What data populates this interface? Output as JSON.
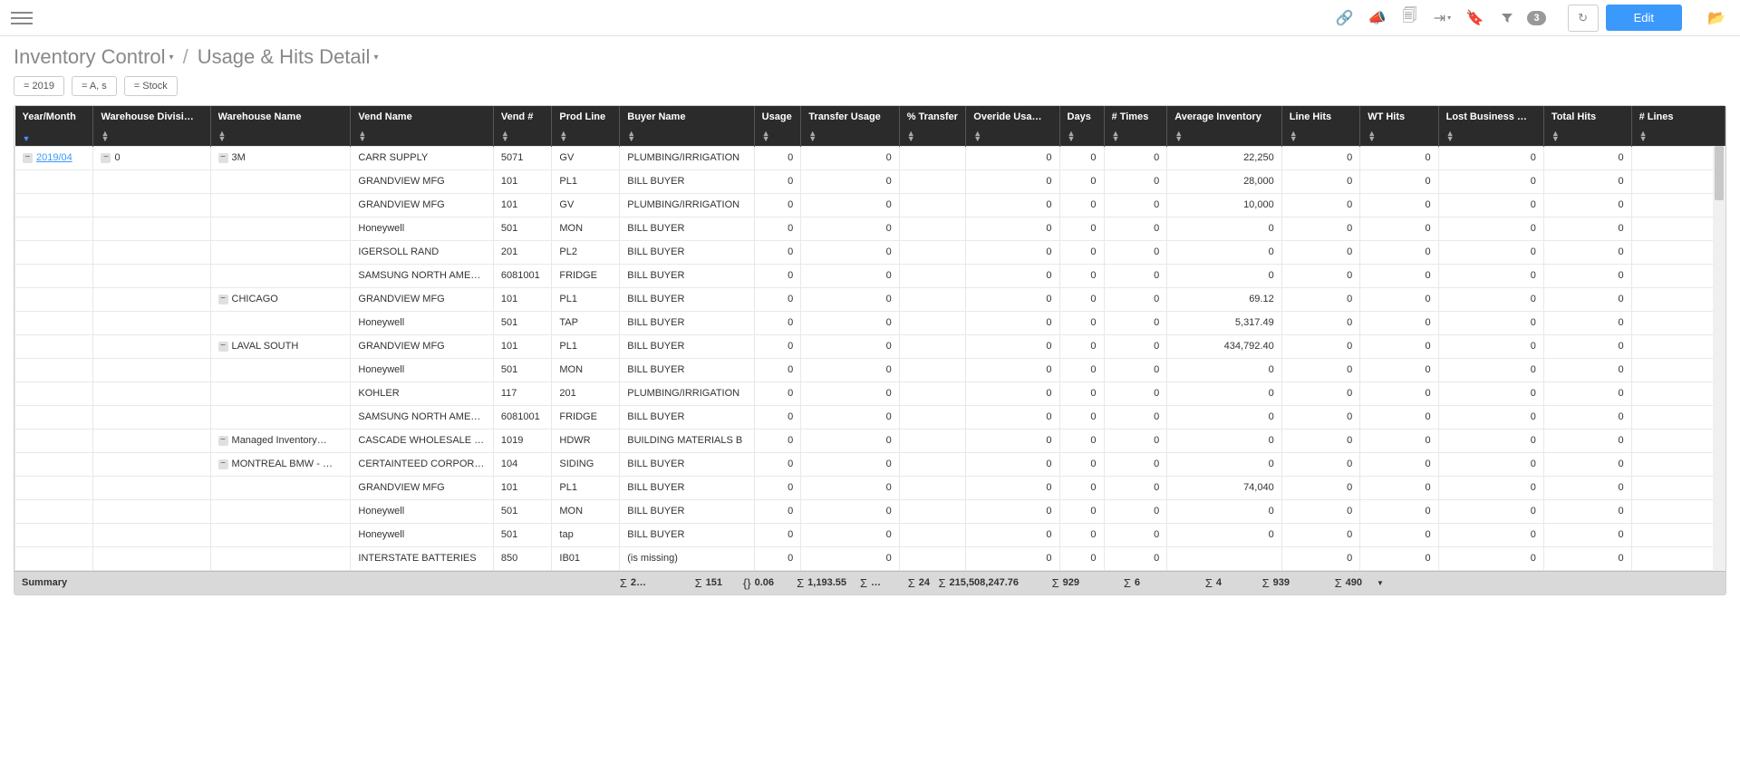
{
  "toolbar": {
    "edit_label": "Edit",
    "filter_count": "3"
  },
  "breadcrumb": {
    "parent": "Inventory Control",
    "current": "Usage & Hits Detail"
  },
  "filters": [
    {
      "label": "= 2019"
    },
    {
      "label": "= A, s"
    },
    {
      "label": "= Stock"
    }
  ],
  "columns": [
    {
      "key": "ym",
      "label": "Year/Month",
      "sorted": true
    },
    {
      "key": "wd",
      "label": "Warehouse Divisi…"
    },
    {
      "key": "wn",
      "label": "Warehouse Name"
    },
    {
      "key": "vn",
      "label": "Vend Name"
    },
    {
      "key": "vnum",
      "label": "Vend #"
    },
    {
      "key": "pl",
      "label": "Prod Line"
    },
    {
      "key": "bn",
      "label": "Buyer Name"
    },
    {
      "key": "u",
      "label": "Usage"
    },
    {
      "key": "tu",
      "label": "Transfer Usage"
    },
    {
      "key": "pt",
      "label": "% Transfer"
    },
    {
      "key": "ou",
      "label": "Overide Usa…"
    },
    {
      "key": "d",
      "label": "Days"
    },
    {
      "key": "nt",
      "label": "# Times"
    },
    {
      "key": "ai",
      "label": "Average Inventory"
    },
    {
      "key": "lh",
      "label": "Line Hits"
    },
    {
      "key": "wt",
      "label": "WT Hits"
    },
    {
      "key": "lb",
      "label": "Lost Business …"
    },
    {
      "key": "th",
      "label": "Total Hits"
    },
    {
      "key": "nl",
      "label": "# Lines"
    }
  ],
  "rows": [
    {
      "ym": "2019/04",
      "wd": "0",
      "wn": "3M",
      "vn": "CARR SUPPLY",
      "vnum": "5071",
      "pl": "GV",
      "bn": "PLUMBING/IRRIGATION",
      "u": "0",
      "tu": "0",
      "pt": "",
      "ou": "0",
      "d": "0",
      "nt": "0",
      "ai": "22,250",
      "lh": "0",
      "wt": "0",
      "lb": "0",
      "th": "0",
      "nl": ""
    },
    {
      "ym": "",
      "wd": "",
      "wn": "",
      "vn": "GRANDVIEW MFG",
      "vnum": "101",
      "pl": "PL1",
      "bn": "BILL BUYER",
      "u": "0",
      "tu": "0",
      "pt": "",
      "ou": "0",
      "d": "0",
      "nt": "0",
      "ai": "28,000",
      "lh": "0",
      "wt": "0",
      "lb": "0",
      "th": "0",
      "nl": ""
    },
    {
      "ym": "",
      "wd": "",
      "wn": "",
      "vn": "GRANDVIEW MFG",
      "vnum": "101",
      "pl": "GV",
      "bn": "PLUMBING/IRRIGATION",
      "u": "0",
      "tu": "0",
      "pt": "",
      "ou": "0",
      "d": "0",
      "nt": "0",
      "ai": "10,000",
      "lh": "0",
      "wt": "0",
      "lb": "0",
      "th": "0",
      "nl": ""
    },
    {
      "ym": "",
      "wd": "",
      "wn": "",
      "vn": "Honeywell",
      "vnum": "501",
      "pl": "MON",
      "bn": "BILL BUYER",
      "u": "0",
      "tu": "0",
      "pt": "",
      "ou": "0",
      "d": "0",
      "nt": "0",
      "ai": "0",
      "lh": "0",
      "wt": "0",
      "lb": "0",
      "th": "0",
      "nl": ""
    },
    {
      "ym": "",
      "wd": "",
      "wn": "",
      "vn": "IGERSOLL RAND",
      "vnum": "201",
      "pl": "PL2",
      "bn": "BILL BUYER",
      "u": "0",
      "tu": "0",
      "pt": "",
      "ou": "0",
      "d": "0",
      "nt": "0",
      "ai": "0",
      "lh": "0",
      "wt": "0",
      "lb": "0",
      "th": "0",
      "nl": ""
    },
    {
      "ym": "",
      "wd": "",
      "wn": "",
      "vn": "SAMSUNG NORTH AME…",
      "vnum": "6081001",
      "pl": "FRIDGE",
      "bn": "BILL BUYER",
      "u": "0",
      "tu": "0",
      "pt": "",
      "ou": "0",
      "d": "0",
      "nt": "0",
      "ai": "0",
      "lh": "0",
      "wt": "0",
      "lb": "0",
      "th": "0",
      "nl": ""
    },
    {
      "ym": "",
      "wd": "",
      "wn": "CHICAGO",
      "vn": "GRANDVIEW MFG",
      "vnum": "101",
      "pl": "PL1",
      "bn": "BILL BUYER",
      "u": "0",
      "tu": "0",
      "pt": "",
      "ou": "0",
      "d": "0",
      "nt": "0",
      "ai": "69.12",
      "lh": "0",
      "wt": "0",
      "lb": "0",
      "th": "0",
      "nl": ""
    },
    {
      "ym": "",
      "wd": "",
      "wn": "",
      "vn": "Honeywell",
      "vnum": "501",
      "pl": "TAP",
      "bn": "BILL BUYER",
      "u": "0",
      "tu": "0",
      "pt": "",
      "ou": "0",
      "d": "0",
      "nt": "0",
      "ai": "5,317.49",
      "lh": "0",
      "wt": "0",
      "lb": "0",
      "th": "0",
      "nl": ""
    },
    {
      "ym": "",
      "wd": "",
      "wn": "LAVAL SOUTH",
      "vn": "GRANDVIEW MFG",
      "vnum": "101",
      "pl": "PL1",
      "bn": "BILL BUYER",
      "u": "0",
      "tu": "0",
      "pt": "",
      "ou": "0",
      "d": "0",
      "nt": "0",
      "ai": "434,792.40",
      "lh": "0",
      "wt": "0",
      "lb": "0",
      "th": "0",
      "nl": ""
    },
    {
      "ym": "",
      "wd": "",
      "wn": "",
      "vn": "Honeywell",
      "vnum": "501",
      "pl": "MON",
      "bn": "BILL BUYER",
      "u": "0",
      "tu": "0",
      "pt": "",
      "ou": "0",
      "d": "0",
      "nt": "0",
      "ai": "0",
      "lh": "0",
      "wt": "0",
      "lb": "0",
      "th": "0",
      "nl": ""
    },
    {
      "ym": "",
      "wd": "",
      "wn": "",
      "vn": "KOHLER",
      "vnum": "117",
      "pl": "201",
      "bn": "PLUMBING/IRRIGATION",
      "u": "0",
      "tu": "0",
      "pt": "",
      "ou": "0",
      "d": "0",
      "nt": "0",
      "ai": "0",
      "lh": "0",
      "wt": "0",
      "lb": "0",
      "th": "0",
      "nl": ""
    },
    {
      "ym": "",
      "wd": "",
      "wn": "",
      "vn": "SAMSUNG NORTH AME…",
      "vnum": "6081001",
      "pl": "FRIDGE",
      "bn": "BILL BUYER",
      "u": "0",
      "tu": "0",
      "pt": "",
      "ou": "0",
      "d": "0",
      "nt": "0",
      "ai": "0",
      "lh": "0",
      "wt": "0",
      "lb": "0",
      "th": "0",
      "nl": ""
    },
    {
      "ym": "",
      "wd": "",
      "wn": "Managed Inventory…",
      "vn": "CASCADE WHOLESALE …",
      "vnum": "1019",
      "pl": "HDWR",
      "bn": "BUILDING MATERIALS B",
      "u": "0",
      "tu": "0",
      "pt": "",
      "ou": "0",
      "d": "0",
      "nt": "0",
      "ai": "0",
      "lh": "0",
      "wt": "0",
      "lb": "0",
      "th": "0",
      "nl": ""
    },
    {
      "ym": "",
      "wd": "",
      "wn": "MONTREAL BMW - …",
      "vn": "CERTAINTEED CORPOR…",
      "vnum": "104",
      "pl": "SIDING",
      "bn": "BILL BUYER",
      "u": "0",
      "tu": "0",
      "pt": "",
      "ou": "0",
      "d": "0",
      "nt": "0",
      "ai": "0",
      "lh": "0",
      "wt": "0",
      "lb": "0",
      "th": "0",
      "nl": ""
    },
    {
      "ym": "",
      "wd": "",
      "wn": "",
      "vn": "GRANDVIEW MFG",
      "vnum": "101",
      "pl": "PL1",
      "bn": "BILL BUYER",
      "u": "0",
      "tu": "0",
      "pt": "",
      "ou": "0",
      "d": "0",
      "nt": "0",
      "ai": "74,040",
      "lh": "0",
      "wt": "0",
      "lb": "0",
      "th": "0",
      "nl": ""
    },
    {
      "ym": "",
      "wd": "",
      "wn": "",
      "vn": "Honeywell",
      "vnum": "501",
      "pl": "MON",
      "bn": "BILL BUYER",
      "u": "0",
      "tu": "0",
      "pt": "",
      "ou": "0",
      "d": "0",
      "nt": "0",
      "ai": "0",
      "lh": "0",
      "wt": "0",
      "lb": "0",
      "th": "0",
      "nl": ""
    },
    {
      "ym": "",
      "wd": "",
      "wn": "",
      "vn": "Honeywell",
      "vnum": "501",
      "pl": "tap",
      "bn": "BILL BUYER",
      "u": "0",
      "tu": "0",
      "pt": "",
      "ou": "0",
      "d": "0",
      "nt": "0",
      "ai": "0",
      "lh": "0",
      "wt": "0",
      "lb": "0",
      "th": "0",
      "nl": ""
    },
    {
      "ym": "",
      "wd": "",
      "wn": "",
      "vn": "INTERSTATE BATTERIES",
      "vnum": "850",
      "pl": "IB01",
      "bn": "(is missing)",
      "u": "0",
      "tu": "0",
      "pt": "",
      "ou": "0",
      "d": "0",
      "nt": "0",
      "ai": "",
      "lh": "0",
      "wt": "0",
      "lb": "0",
      "th": "0",
      "nl": ""
    }
  ],
  "summary": {
    "label": "Summary",
    "u": "2…",
    "tu": "151",
    "pt": "0.06",
    "ou": "1,193.55",
    "d": "…",
    "nt": "24",
    "ai": "215,508,247.76",
    "lh": "929",
    "wt": "6",
    "lb": "4",
    "th": "939",
    "nl": "490"
  }
}
